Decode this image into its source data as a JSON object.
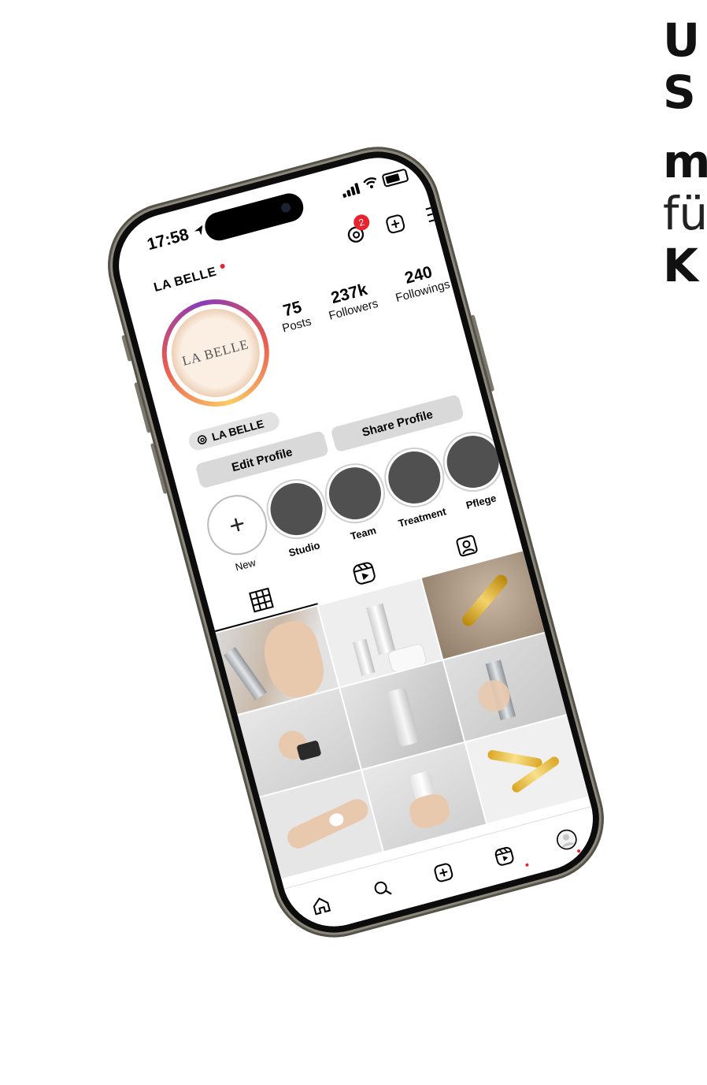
{
  "side_text": {
    "line1": "U",
    "line2": "S",
    "line3": "m",
    "line4": "fü",
    "line5": "K"
  },
  "status_bar": {
    "time": "17:58"
  },
  "header": {
    "threads_badge": "2"
  },
  "profile": {
    "username": "LA BELLE",
    "avatar_text": "LA BELLE",
    "threads_handle": "LA BELLE",
    "stats": [
      {
        "value": "75",
        "label": "Posts"
      },
      {
        "value": "237k",
        "label": "Followers"
      },
      {
        "value": "240",
        "label": "Followings"
      }
    ],
    "edit_label": "Edit Profile",
    "share_label": "Share Profile"
  },
  "highlights": [
    {
      "label": "New"
    },
    {
      "label": "Studio"
    },
    {
      "label": "Team"
    },
    {
      "label": "Treatment"
    },
    {
      "label": "Pflege"
    }
  ],
  "colors": {
    "accent_red": "#e8232d",
    "button_gray": "#d9d9d9",
    "frame": "#8c877b"
  }
}
